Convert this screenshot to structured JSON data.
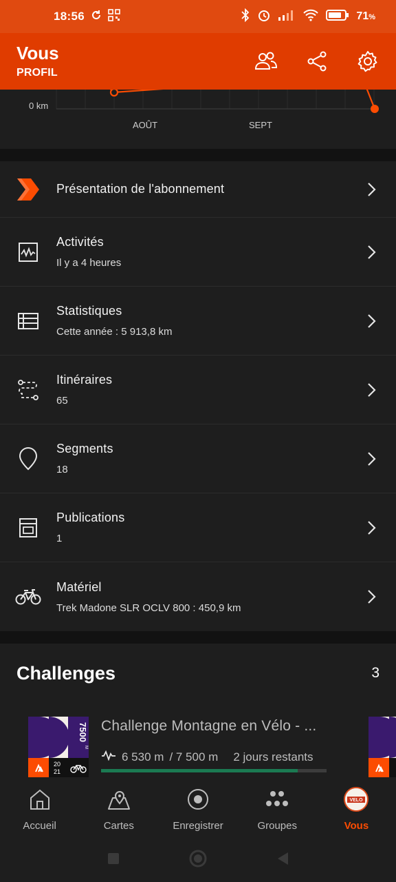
{
  "status_bar": {
    "time": "18:56",
    "battery": "71"
  },
  "header": {
    "title": "Vous",
    "subtitle": "PROFIL"
  },
  "chart_data": {
    "type": "line",
    "y_tick_labels": [
      "0 km"
    ],
    "x_tick_labels": [
      "AOÛT",
      "SEPT"
    ],
    "accent_color": "#fc4c02"
  },
  "menu": {
    "items": [
      {
        "label": "Présentation de l'abonnement",
        "sub": ""
      },
      {
        "label": "Activités",
        "sub": "Il y a 4 heures"
      },
      {
        "label": "Statistiques",
        "sub": "Cette année : 5 913,8 km"
      },
      {
        "label": "Itinéraires",
        "sub": "65"
      },
      {
        "label": "Segments",
        "sub": "18"
      },
      {
        "label": "Publications",
        "sub": "1"
      },
      {
        "label": "Matériel",
        "sub": "Trek Madone SLR OCLV 800 : 450,9 km"
      }
    ]
  },
  "challenges": {
    "title": "Challenges",
    "count": "3",
    "item": {
      "name": "Challenge Montagne en Vélo - ...",
      "current": "6 530 m",
      "goal": "/ 7 500 m",
      "remaining": "2 jours restants",
      "progress": 0.8707,
      "badge_goal": "7500",
      "badge_unit": "M",
      "badge_year_top": "20",
      "badge_year_bottom": "21"
    }
  },
  "bottom_nav": {
    "items": [
      {
        "label": "Accueil"
      },
      {
        "label": "Cartes"
      },
      {
        "label": "Enregistrer"
      },
      {
        "label": "Groupes"
      },
      {
        "label": "Vous"
      }
    ],
    "avatar_text": "VELO"
  },
  "colors": {
    "brand_orange": "#fc4c02",
    "header_orange": "#e03c00",
    "progress_green": "#1b7a52"
  }
}
